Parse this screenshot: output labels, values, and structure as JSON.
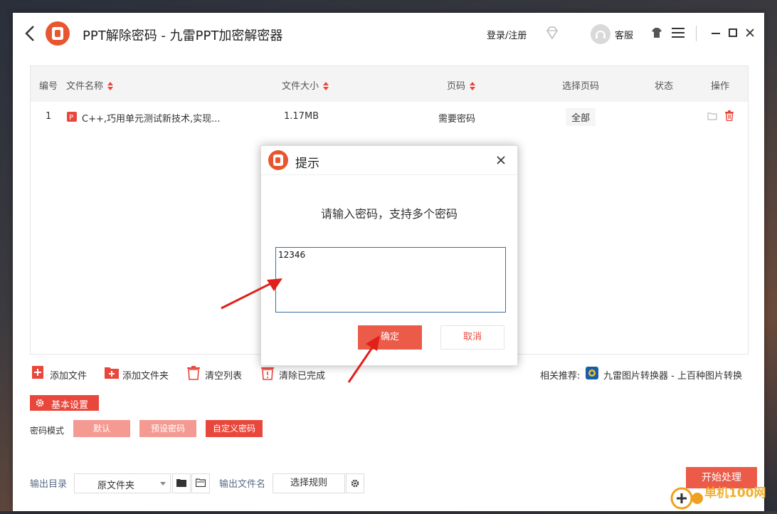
{
  "app": {
    "title": "PPT解除密码 - 九雷PPT加密解密器",
    "login_label": "登录/注册",
    "service_label": "客服"
  },
  "table": {
    "headers": [
      "编号",
      "文件名称",
      "文件大小",
      "页码",
      "选择页码",
      "状态",
      "操作"
    ],
    "rows": [
      {
        "index": "1",
        "name": "C++,巧用单元测试新技术,实现...",
        "size": "1.17MB",
        "pages": "需要密码",
        "select_pages": "全部",
        "status": ""
      }
    ]
  },
  "actions": {
    "add_file": "添加文件",
    "add_folder": "添加文件夹",
    "clear_list": "清空列表",
    "clear_done": "清除已完成",
    "related_label": "相关推荐:",
    "related_link": "九雷图片转换器 - 上百种图片转换"
  },
  "settings": {
    "basic_label": "基本设置",
    "password_mode_label": "密码模式",
    "modes": [
      "默认",
      "预设密码",
      "自定义密码"
    ],
    "selected_mode": "自定义密码"
  },
  "output": {
    "dir_label": "输出目录",
    "dir_value": "原文件夹",
    "name_label": "输出文件名",
    "rule_button": "选择规则",
    "start_button": "开始处理"
  },
  "dialog": {
    "title": "提示",
    "message": "请输入密码，支持多个密码",
    "password_value": "12346",
    "ok_label": "确定",
    "cancel_label": "取消"
  },
  "watermark": {
    "text": "单机100网",
    "url": "danji100.com"
  },
  "colors": {
    "accent": "#e9473b",
    "accent_light": "#f49a92",
    "input_border": "#3a6ea5"
  }
}
